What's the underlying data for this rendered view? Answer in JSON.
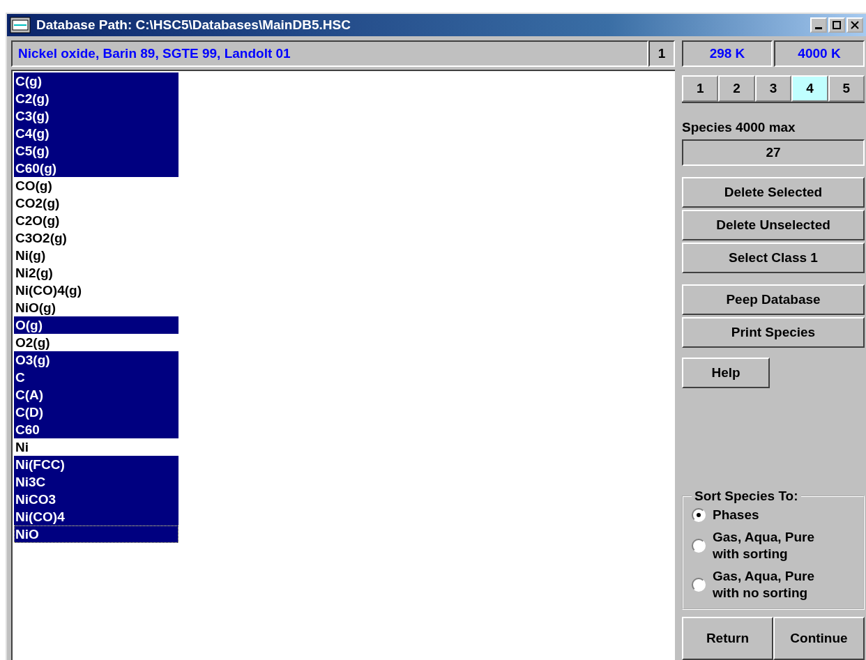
{
  "window": {
    "title": "Database Path: C:\\HSC5\\Databases\\MainDB5.HSC"
  },
  "description": {
    "text": "Nickel oxide, Barin 89, SGTE 99, Landolt 01",
    "count": "1"
  },
  "temperatures": [
    "298 K",
    "4000 K"
  ],
  "tabs": [
    {
      "label": "1",
      "selected": false
    },
    {
      "label": "2",
      "selected": false
    },
    {
      "label": "3",
      "selected": false
    },
    {
      "label": "4",
      "selected": true
    },
    {
      "label": "5",
      "selected": false
    }
  ],
  "species_label": "Species 4000 max",
  "species_count": "27",
  "species": [
    {
      "name": "C(g)",
      "selected": true,
      "focused": false
    },
    {
      "name": "C2(g)",
      "selected": true,
      "focused": false
    },
    {
      "name": "C3(g)",
      "selected": true,
      "focused": false
    },
    {
      "name": "C4(g)",
      "selected": true,
      "focused": false
    },
    {
      "name": "C5(g)",
      "selected": true,
      "focused": false
    },
    {
      "name": "C60(g)",
      "selected": true,
      "focused": false
    },
    {
      "name": "CO(g)",
      "selected": false,
      "focused": false
    },
    {
      "name": "CO2(g)",
      "selected": false,
      "focused": false
    },
    {
      "name": "C2O(g)",
      "selected": false,
      "focused": false
    },
    {
      "name": "C3O2(g)",
      "selected": false,
      "focused": false
    },
    {
      "name": "Ni(g)",
      "selected": false,
      "focused": false
    },
    {
      "name": "Ni2(g)",
      "selected": false,
      "focused": false
    },
    {
      "name": "Ni(CO)4(g)",
      "selected": false,
      "focused": false
    },
    {
      "name": "NiO(g)",
      "selected": false,
      "focused": false
    },
    {
      "name": "O(g)",
      "selected": true,
      "focused": false
    },
    {
      "name": "O2(g)",
      "selected": false,
      "focused": false
    },
    {
      "name": "O3(g)",
      "selected": true,
      "focused": false
    },
    {
      "name": "C",
      "selected": true,
      "focused": false
    },
    {
      "name": "C(A)",
      "selected": true,
      "focused": false
    },
    {
      "name": "C(D)",
      "selected": true,
      "focused": false
    },
    {
      "name": "C60",
      "selected": true,
      "focused": false
    },
    {
      "name": "Ni",
      "selected": false,
      "focused": false
    },
    {
      "name": "Ni(FCC)",
      "selected": true,
      "focused": false
    },
    {
      "name": "Ni3C",
      "selected": true,
      "focused": false
    },
    {
      "name": "NiCO3",
      "selected": true,
      "focused": false
    },
    {
      "name": "Ni(CO)4",
      "selected": true,
      "focused": false
    },
    {
      "name": "NiO",
      "selected": true,
      "focused": true
    }
  ],
  "action_buttons": [
    [
      "Delete Selected",
      "Delete Unselected",
      "Select Class 1"
    ],
    [
      "Peep Database",
      "Print Species"
    ]
  ],
  "help_button": "Help",
  "sort_group": {
    "title": "Sort Species To:",
    "options": [
      {
        "label": "Phases",
        "selected": true
      },
      {
        "label": "Gas, Aqua, Pure\nwith sorting",
        "selected": false
      },
      {
        "label": "Gas, Aqua, Pure\nwith no sorting",
        "selected": false
      }
    ]
  },
  "bottom_buttons": [
    "Return",
    "Continue"
  ]
}
